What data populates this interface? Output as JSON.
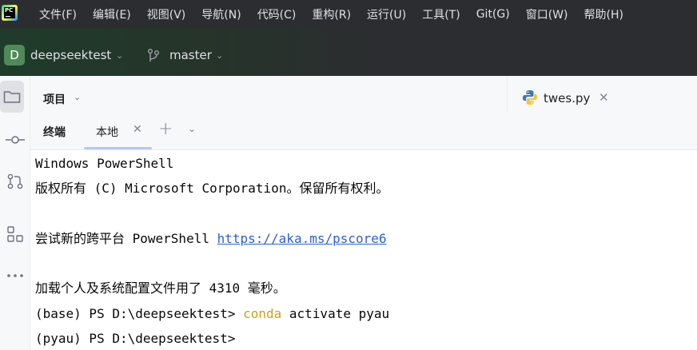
{
  "menubar": {
    "items": [
      "文件(F)",
      "编辑(E)",
      "视图(V)",
      "导航(N)",
      "代码(C)",
      "重构(R)",
      "运行(U)",
      "工具(T)",
      "Git(G)",
      "窗口(W)",
      "帮助(H)"
    ]
  },
  "header": {
    "project_initial": "D",
    "project_name": "deepseektest",
    "branch": "master"
  },
  "project_panel": {
    "title": "项目"
  },
  "editor": {
    "tab_label": "twes.py"
  },
  "terminal": {
    "panel_title": "终端",
    "tab_label": "本地",
    "lines": {
      "l1": "Windows PowerShell",
      "l2": "版权所有 (C) Microsoft Corporation。保留所有权利。",
      "l3_prefix": "尝试新的跨平台 PowerShell ",
      "l3_link": "https://aka.ms/pscore6",
      "l4": "加载个人及系统配置文件用了 4310 毫秒。",
      "l5_prompt": "(base) PS D:\\deepseektest> ",
      "l5_cmd": "conda",
      "l5_args": " activate pyau",
      "l6": "(pyau) PS D:\\deepseektest>"
    }
  },
  "colors": {
    "menubar_bg": "#2b2d30",
    "link": "#2a5fd8",
    "command_highlight": "#c9a219",
    "project_badge": "#4f8a58"
  }
}
